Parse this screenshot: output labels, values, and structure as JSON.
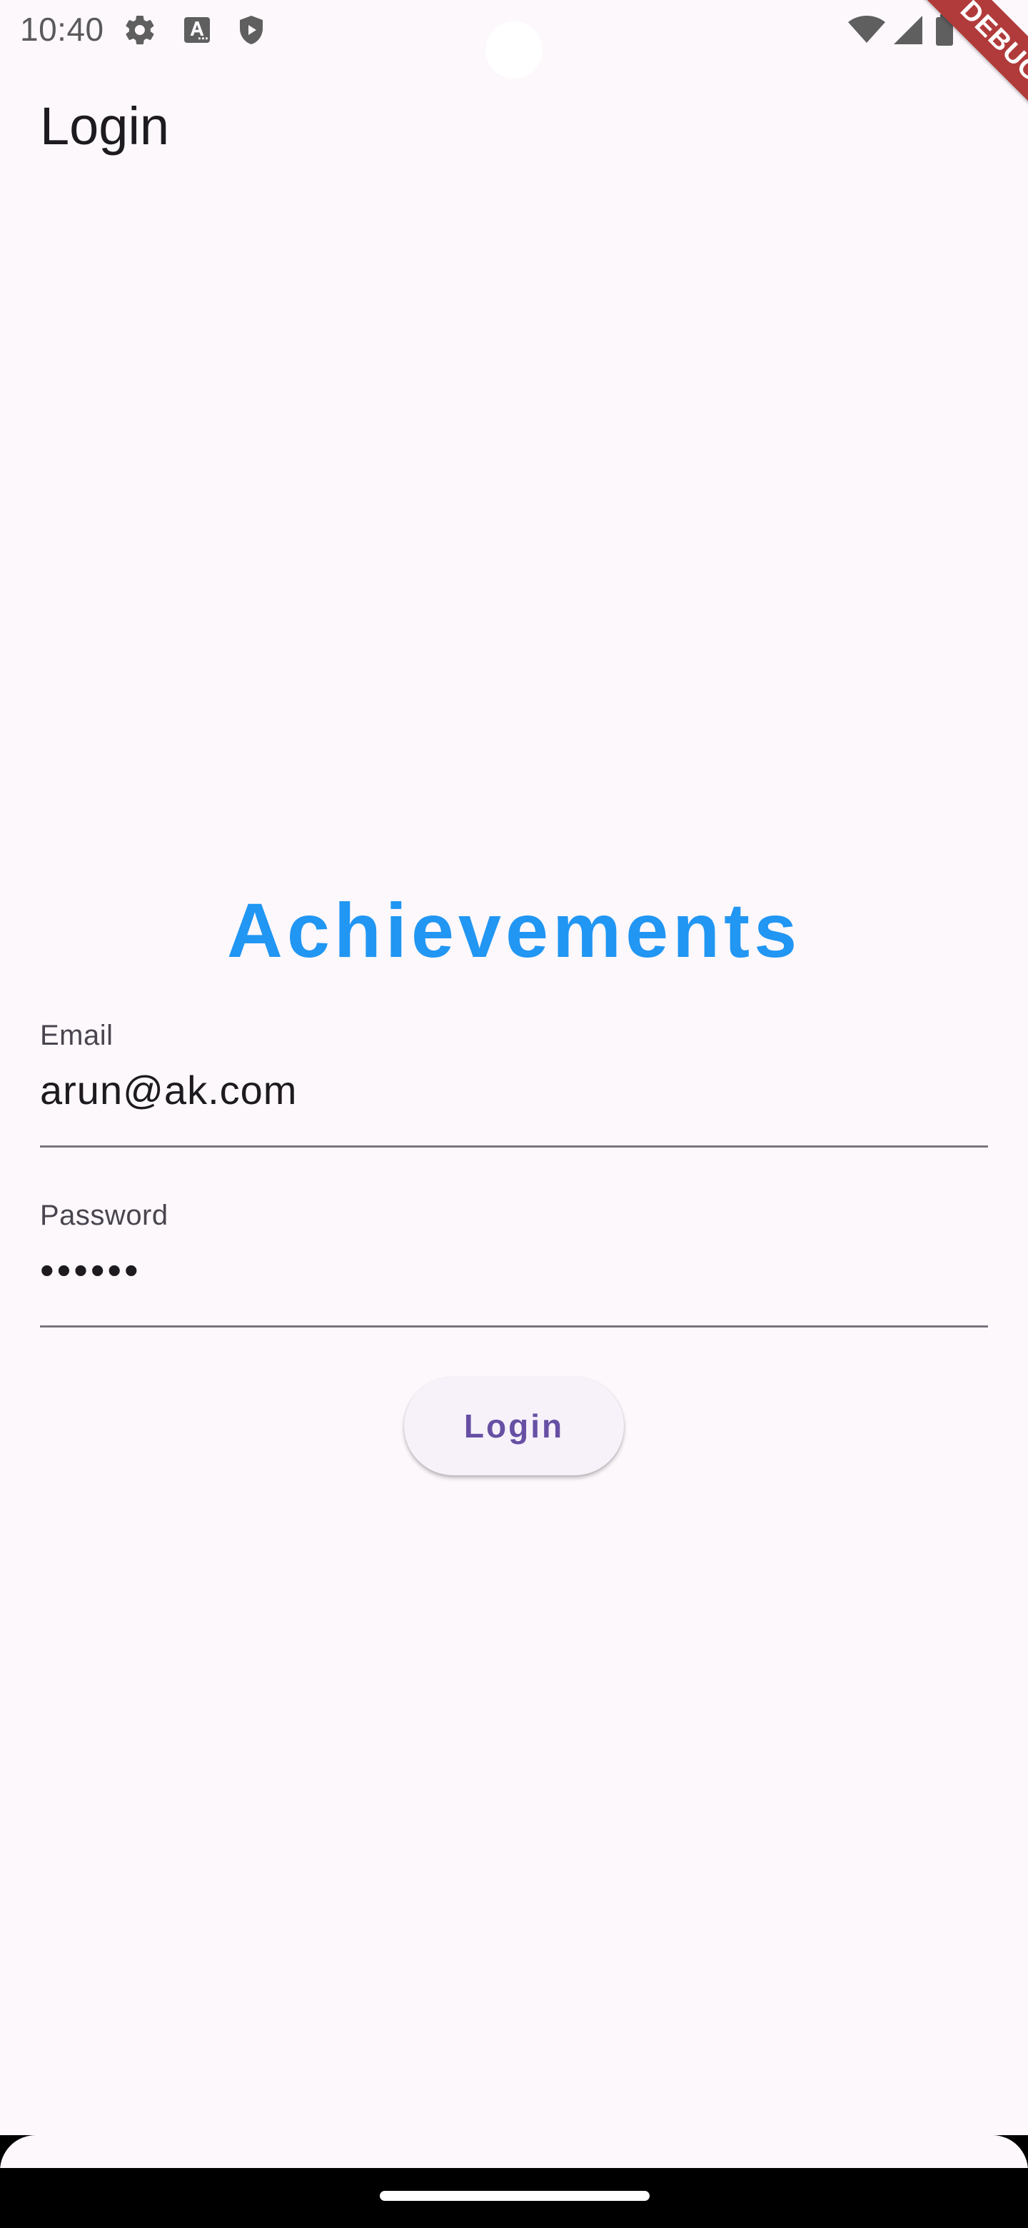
{
  "status_bar": {
    "time": "10:40",
    "icons": [
      "gear-icon",
      "text-a-icon",
      "shield-play-icon",
      "wifi-icon",
      "signal-icon",
      "battery-icon"
    ]
  },
  "debug_banner": "DEBUG",
  "app_bar": {
    "title": "Login"
  },
  "logo": {
    "text": "Achievements",
    "color": "#2196f3"
  },
  "form": {
    "email": {
      "label": "Email",
      "value": "arun@ak.com"
    },
    "password": {
      "label": "Password",
      "value": "••••••"
    },
    "login_button": "Login"
  },
  "colors": {
    "background": "#fdf8fc",
    "button_text": "#6750a4",
    "button_bg": "#f7f2fa",
    "debug_banner": "#b13b3b"
  }
}
